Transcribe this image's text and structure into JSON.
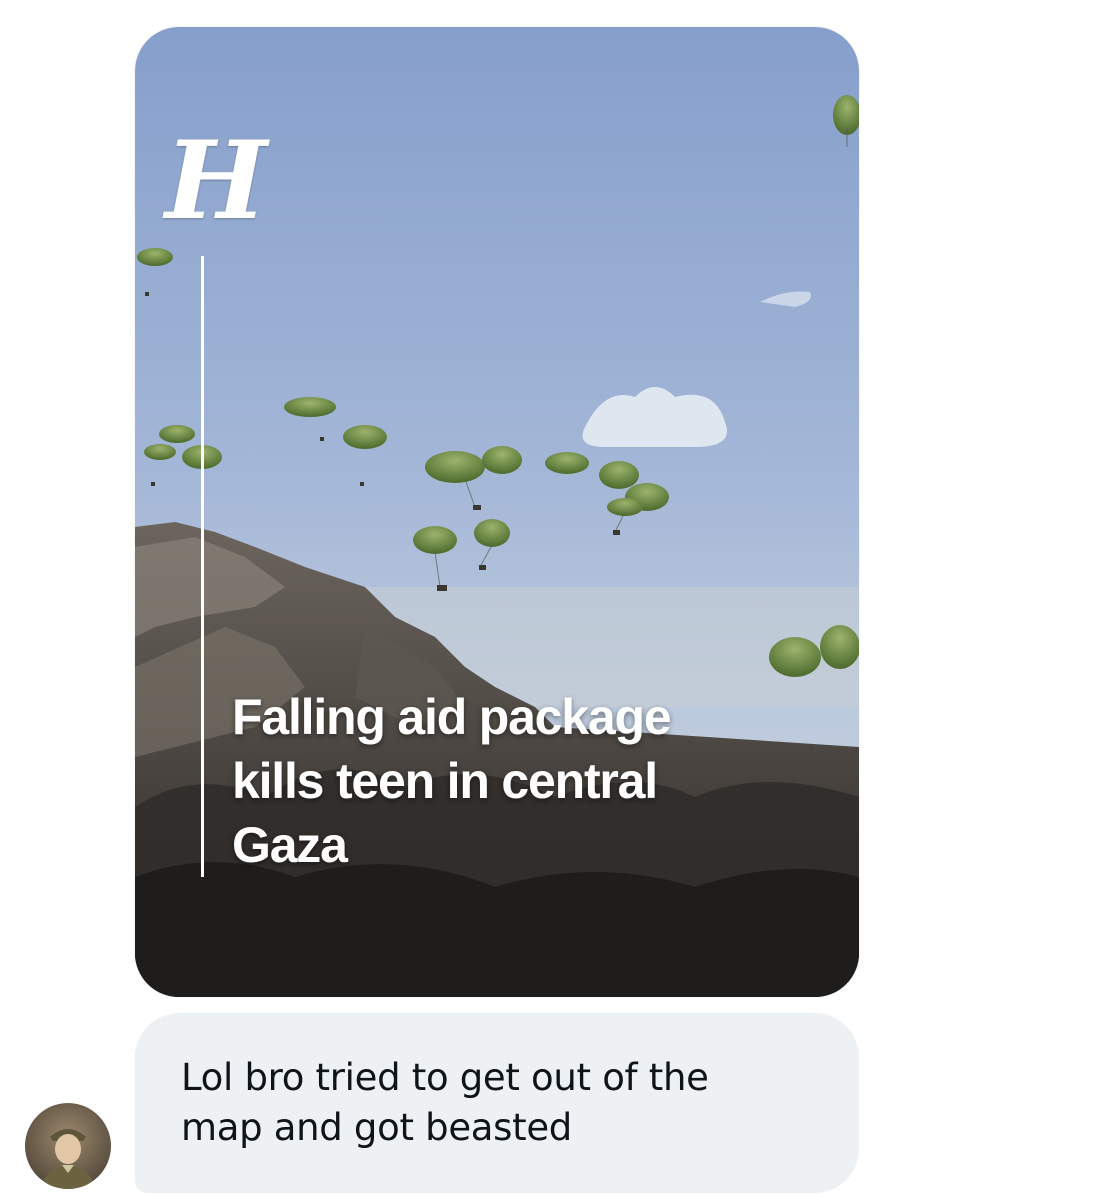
{
  "card": {
    "masthead_letter": "H",
    "headline": "Falling aid package\nkills teen in central\nGaza"
  },
  "message": {
    "text": "Lol bro tried to get out of the\nmap and got beasted"
  },
  "colors": {
    "sky_top": "#8fa7cf",
    "sky_bottom": "#b9c8dc",
    "parachute": "#6e8a45",
    "bubble_bg": "#eef1f3",
    "text": "#0f1419"
  },
  "icons": {
    "avatar": "user-avatar-soldier"
  }
}
